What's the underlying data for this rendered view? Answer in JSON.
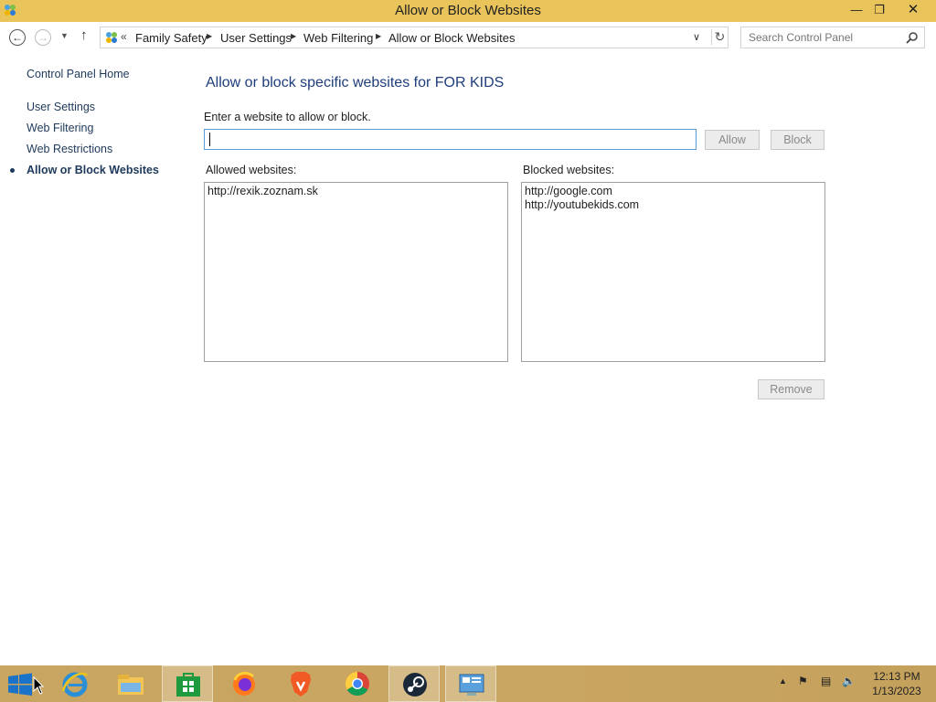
{
  "window": {
    "title": "Allow or Block Websites",
    "minimize_icon": "minimize-icon",
    "maximize_icon": "restore-icon",
    "close_icon": "close-icon"
  },
  "address_bar": {
    "overflow": "«",
    "breadcrumbs": [
      "Family Safety",
      "User Settings",
      "Web Filtering",
      "Allow or Block Websites"
    ]
  },
  "search": {
    "placeholder": "Search Control Panel"
  },
  "sidebar": {
    "home": "Control Panel Home",
    "items": [
      {
        "label": "User Settings",
        "current": false
      },
      {
        "label": "Web Filtering",
        "current": false
      },
      {
        "label": "Web Restrictions",
        "current": false
      },
      {
        "label": "Allow or Block Websites",
        "current": true
      }
    ]
  },
  "main": {
    "heading": "Allow or block specific websites for FOR KIDS",
    "prompt": "Enter a website to allow or block.",
    "input_value": "",
    "allow_label": "Allow",
    "block_label": "Block",
    "allowed_label": "Allowed websites:",
    "blocked_label": "Blocked websites:",
    "allowed_sites": [
      "http://rexik.zoznam.sk"
    ],
    "blocked_sites": [
      "http://google.com",
      "http://youtubekids.com"
    ],
    "remove_label": "Remove"
  },
  "taskbar": {
    "apps": [
      "windows-start-icon",
      "internet-explorer-icon",
      "file-explorer-icon",
      "store-icon",
      "firefox-icon",
      "brave-icon",
      "chrome-icon",
      "steam-icon",
      "control-panel-icon"
    ],
    "time": "12:13 PM",
    "date": "1/13/2023"
  },
  "colors": {
    "titlebar": "#e9c45a",
    "taskbar": "#c9a662",
    "link": "#1e395b",
    "heading": "#1e3d7b"
  }
}
